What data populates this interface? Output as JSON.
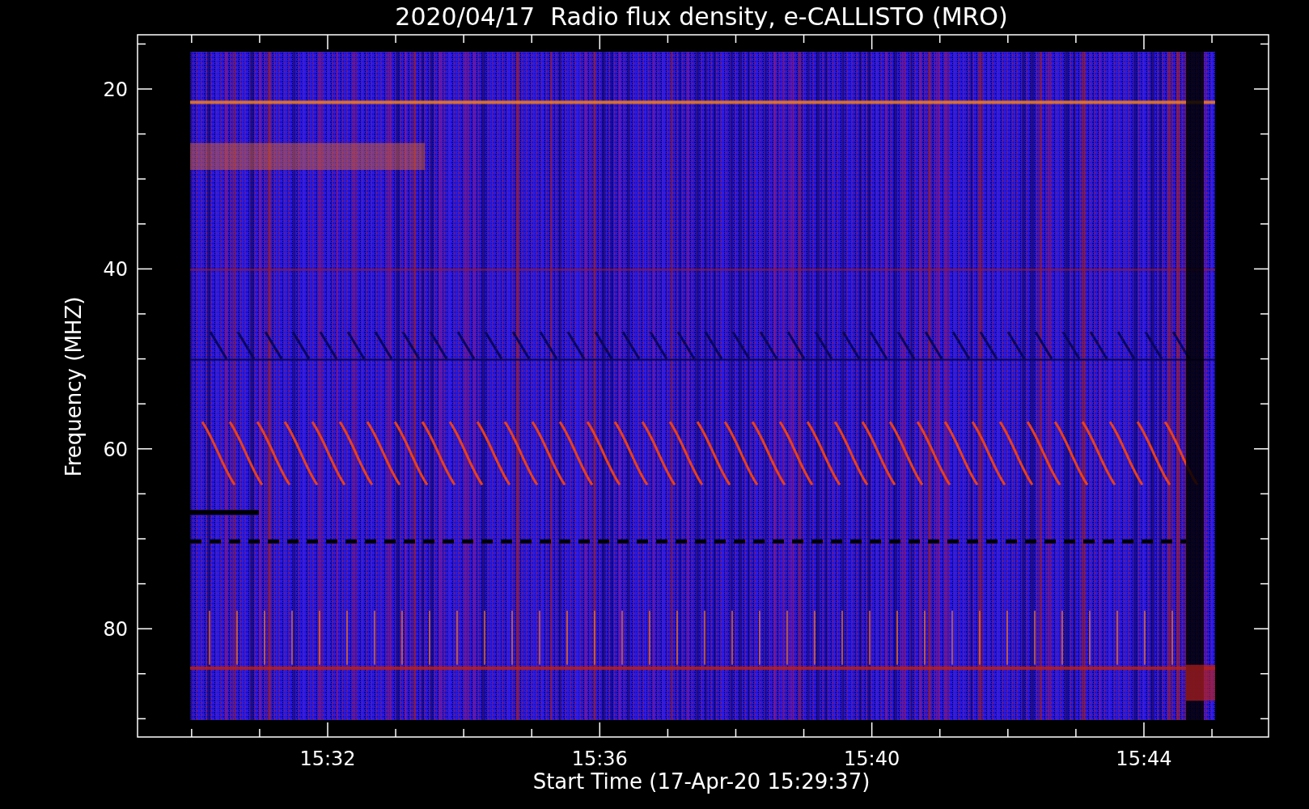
{
  "title": "2020/04/17  Radio flux density, e-CALLISTO (MRO)",
  "y_axis": {
    "label": "Frequency (MHZ)",
    "ticks": [
      "20",
      "40",
      "60",
      "80"
    ]
  },
  "x_axis": {
    "label": "Start Time (17-Apr-20 15:29:37)",
    "ticks": [
      "15:32",
      "15:36",
      "15:40",
      "15:44"
    ]
  }
}
